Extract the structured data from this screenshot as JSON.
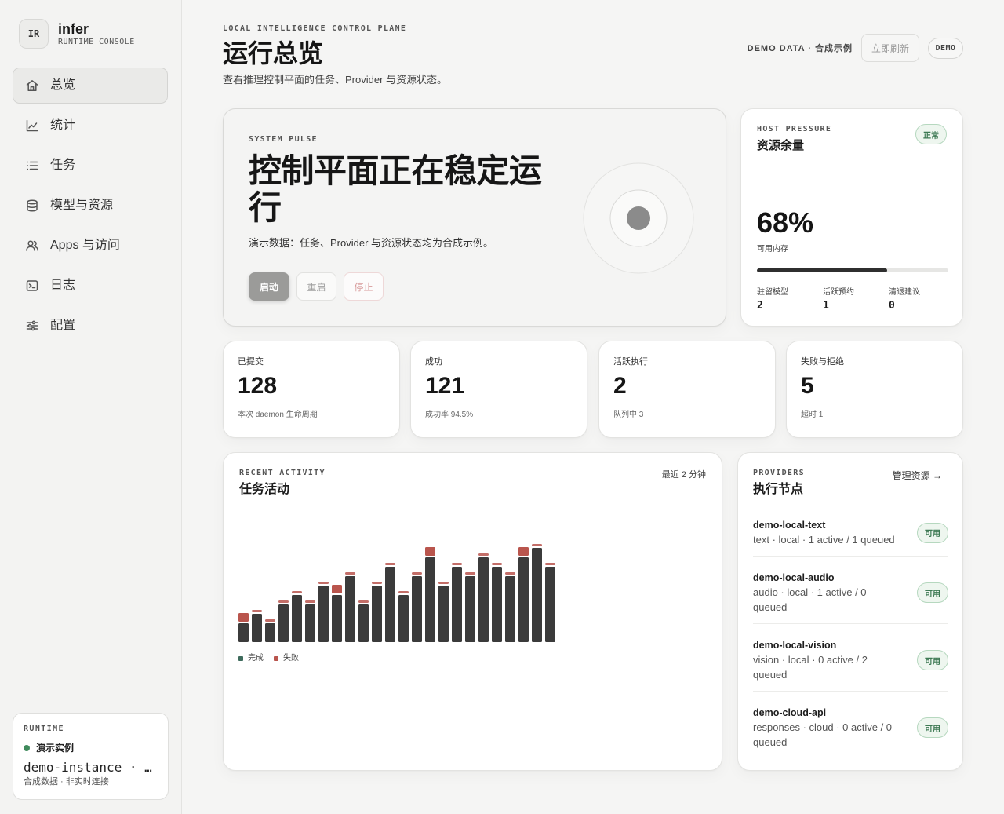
{
  "app": {
    "logo_text": "IR",
    "name": "infer",
    "subtitle": "RUNTIME CONSOLE"
  },
  "sidebar": {
    "items": [
      {
        "label": "总览",
        "icon": "home-icon",
        "active": true
      },
      {
        "label": "统计",
        "icon": "chart-line-icon",
        "active": false
      },
      {
        "label": "任务",
        "icon": "list-icon",
        "active": false
      },
      {
        "label": "模型与资源",
        "icon": "database-icon",
        "active": false
      },
      {
        "label": "Apps 与访问",
        "icon": "users-icon",
        "active": false
      },
      {
        "label": "日志",
        "icon": "terminal-icon",
        "active": false
      },
      {
        "label": "配置",
        "icon": "sliders-icon",
        "active": false
      }
    ],
    "runtime": {
      "eyebrow": "RUNTIME",
      "status": "演示实例",
      "instance": "demo-instance · …",
      "note": "合成数据 · 非实时连接"
    }
  },
  "header": {
    "eyebrow": "LOCAL INTELLIGENCE CONTROL PLANE",
    "title": "运行总览",
    "subtitle": "查看推理控制平面的任务、Provider 与资源状态。",
    "data_label": "DEMO DATA · 合成示例",
    "refresh_label": "立即刷新",
    "badge": "DEMO"
  },
  "pulse": {
    "eyebrow": "SYSTEM PULSE",
    "title": "控制平面正在稳定运行",
    "description": "演示数据：任务、Provider 与资源状态均为合成示例。",
    "actions": {
      "start": "启动",
      "restart": "重启",
      "stop": "停止"
    }
  },
  "host": {
    "eyebrow": "HOST PRESSURE",
    "title": "资源余量",
    "status": "正常",
    "value": "68%",
    "value_label": "可用内存",
    "available_fraction": 0.68,
    "stats": [
      {
        "label": "驻留模型",
        "value": "2"
      },
      {
        "label": "活跃预约",
        "value": "1"
      },
      {
        "label": "清退建议",
        "value": "0"
      }
    ]
  },
  "metrics": [
    {
      "label": "已提交",
      "value": "128",
      "note": "本次 daemon 生命周期"
    },
    {
      "label": "成功",
      "value": "121",
      "note": "成功率 94.5%"
    },
    {
      "label": "活跃执行",
      "value": "2",
      "note": "队列中 3"
    },
    {
      "label": "失败与拒绝",
      "value": "5",
      "note": "超时 1"
    }
  ],
  "activity": {
    "eyebrow": "RECENT ACTIVITY",
    "title": "任务活动",
    "range": "最近 2 分钟"
  },
  "chart_data": {
    "type": "bar",
    "stacked": true,
    "grid": false,
    "legend": "bottom-left",
    "series": [
      {
        "name": "完成",
        "color": "#3b3b3b",
        "legend_color": "#3e6b5c",
        "values": [
          2,
          3,
          2,
          4,
          5,
          4,
          6,
          5,
          7,
          4,
          6,
          8,
          5,
          7,
          9,
          6,
          8,
          7,
          9,
          8,
          7,
          9,
          10,
          8
        ]
      },
      {
        "name": "失败",
        "color": "#b9554d",
        "legend_color": "#b9554d",
        "values": [
          1,
          0,
          0,
          0,
          0,
          0,
          0,
          1,
          0,
          0,
          0,
          0,
          0,
          0,
          1,
          0,
          0,
          0,
          0,
          0,
          0,
          1,
          0,
          0
        ]
      }
    ]
  },
  "providers": {
    "eyebrow": "PROVIDERS",
    "title": "执行节点",
    "link": "管理资源 →",
    "items": [
      {
        "name": "demo-local-text",
        "detail": "text · local · 1 active / 1 queued",
        "status": "可用"
      },
      {
        "name": "demo-local-audio",
        "detail": "audio · local · 1 active / 0 queued",
        "status": "可用"
      },
      {
        "name": "demo-local-vision",
        "detail": "vision · local · 0 active / 2 queued",
        "status": "可用"
      },
      {
        "name": "demo-cloud-api",
        "detail": "responses · cloud · 0 active / 0 queued",
        "status": "可用"
      }
    ]
  },
  "colors": {
    "page_bg": "#f5f5f4",
    "status_ok": "#3f8a5c",
    "danger": "#b9554d",
    "text": "#1c1c1c"
  }
}
